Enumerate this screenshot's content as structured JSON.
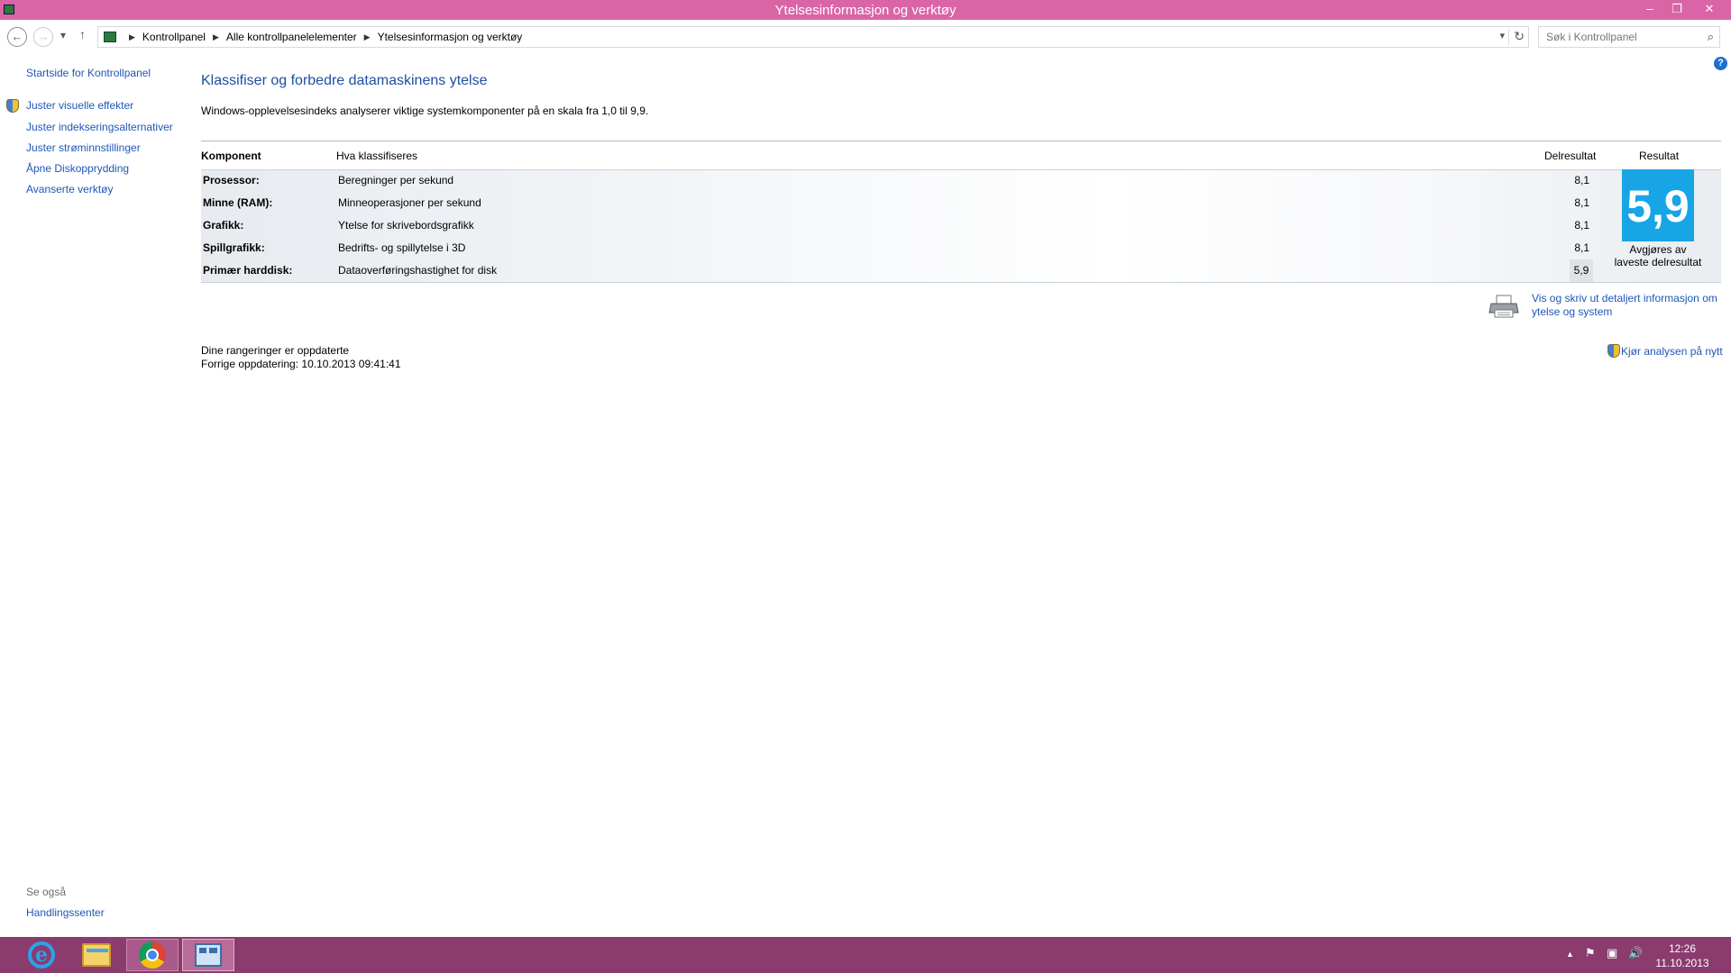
{
  "window": {
    "title": "Ytelsesinformasjon og verktøy",
    "minimize": "–",
    "restore": "❐",
    "close": "✕"
  },
  "address": {
    "back": "←",
    "forward": "→",
    "recent": "▾",
    "up": "↑",
    "breadcrumbs": [
      "Kontrollpanel",
      "Alle kontrollpanelelementer",
      "Ytelsesinformasjon og verktøy"
    ],
    "search_placeholder": "Søk i Kontrollpanel"
  },
  "sidebar": {
    "home": "Startside for Kontrollpanel",
    "items": [
      {
        "label": "Juster visuelle effekter"
      },
      {
        "label": "Juster indekseringsalternativer"
      },
      {
        "label": "Juster strøminnstillinger"
      },
      {
        "label": "Åpne Diskopprydding"
      },
      {
        "label": "Avanserte verktøy"
      }
    ],
    "see_also": "Se også",
    "action_center": "Handlingssenter"
  },
  "main": {
    "heading": "Klassifiser og forbedre datamaskinens ytelse",
    "intro": "Windows-opplevelsesindeks analyserer viktige systemkomponenter på en skala fra 1,0 til 9,9.",
    "columns": {
      "component": "Komponent",
      "what": "Hva klassifiseres",
      "subscore": "Delresultat",
      "score": "Resultat"
    },
    "rows": [
      {
        "component": "Prosessor:",
        "what": "Beregninger per sekund",
        "subscore": "8,1"
      },
      {
        "component": "Minne (RAM):",
        "what": "Minneoperasjoner per sekund",
        "subscore": "8,1"
      },
      {
        "component": "Grafikk:",
        "what": "Ytelse for skrivebordsgrafikk",
        "subscore": "8,1"
      },
      {
        "component": "Spillgrafikk:",
        "what": "Bedrifts- og spillytelse i 3D",
        "subscore": "8,1"
      },
      {
        "component": "Primær harddisk:",
        "what": "Dataoverføringshastighet for disk",
        "subscore": "5,9"
      }
    ],
    "base_score": "5,9",
    "base_score_note": "Avgjøres av laveste delresultat",
    "print_link": "Vis og skriv ut detaljert informasjon om ytelse og system",
    "status_line1": "Dine rangeringer er oppdaterte",
    "status_line2": "Forrige oppdatering: 10.10.2013 09:41:41",
    "rerun_link": "Kjør analysen på nytt"
  },
  "help_label": "?",
  "taskbar": {
    "tray_arrow": "▲",
    "flag": "⚑",
    "network": "▣",
    "volume": "🔊",
    "time": "12:26",
    "date": "11.10.2013"
  },
  "colors": {
    "titlebar": "#d965a6",
    "taskbar": "#8b3b6e",
    "score_tile": "#17a5e6",
    "link": "#1e57b8",
    "heading": "#1e4fa0"
  }
}
